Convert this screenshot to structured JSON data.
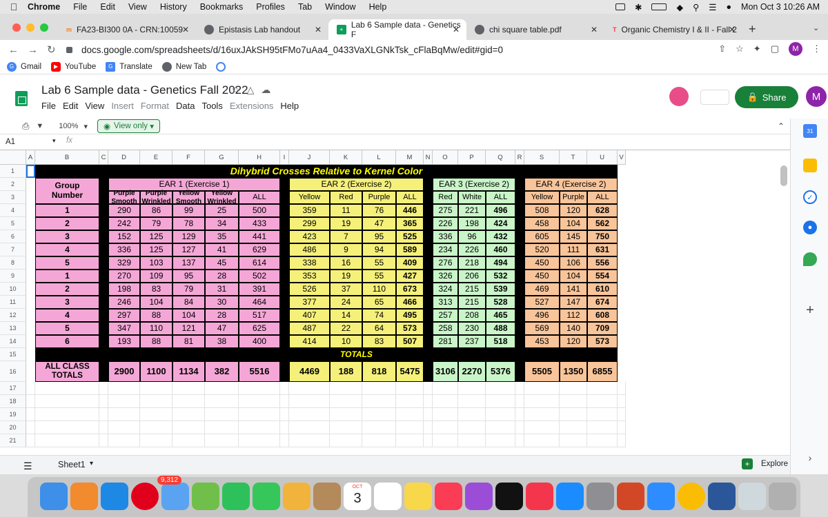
{
  "menubar": {
    "app": "Chrome",
    "items": [
      "File",
      "Edit",
      "View",
      "History",
      "Bookmarks",
      "Profiles",
      "Tab",
      "Window",
      "Help"
    ],
    "clock": "Mon Oct 3  10:26 AM"
  },
  "tabs": [
    {
      "label": "FA23-BI300 0A - CRN:10059",
      "icon": "moodle-icon"
    },
    {
      "label": "Epistasis Lab handout",
      "icon": "globe-icon"
    },
    {
      "label": "Lab 6 Sample data - Genetics F",
      "icon": "sheets-icon"
    },
    {
      "label": "chi square table.pdf",
      "icon": "globe-icon"
    },
    {
      "label": "Organic Chemistry I & II - Fall 2",
      "icon": "tophat-icon"
    }
  ],
  "url": "docs.google.com/spreadsheets/d/16uxJAkSH95tFMo7uAa4_0433VaXLGNkTsk_cFlaBqMw/edit#gid=0",
  "profile_initial": "M",
  "bookmarks": [
    "Gmail",
    "YouTube",
    "Translate",
    "New Tab"
  ],
  "doc": {
    "title": "Lab 6 Sample data - Genetics Fall 2022",
    "menu": [
      "File",
      "Edit",
      "View",
      "Insert",
      "Format",
      "Data",
      "Tools",
      "Extensions",
      "Help"
    ],
    "share_label": "Share",
    "zoom": "100%",
    "view_only": "View only",
    "cell_ref": "A1",
    "fx": "fx"
  },
  "columns": [
    "A",
    "B",
    "C",
    "D",
    "E",
    "F",
    "G",
    "H",
    "I",
    "J",
    "K",
    "L",
    "M",
    "N",
    "O",
    "P",
    "Q",
    "R",
    "S",
    "T",
    "U",
    "V"
  ],
  "rows": [
    "1",
    "2",
    "3",
    "4",
    "5",
    "6",
    "7",
    "8",
    "9",
    "10",
    "11",
    "12",
    "13",
    "14",
    "15",
    "16",
    "17",
    "18",
    "19",
    "20",
    "21"
  ],
  "sheet": {
    "title": "Dihybrid Crosses Relative to Kernel Color",
    "group_header": "Group\nNumber",
    "ear1": {
      "label": "EAR 1 (Exercise 1)",
      "cols": [
        "Purple\nSmooth",
        "Purple\nWrinkled",
        "Yellow\nSmooth",
        "Yellow\nWrinkled",
        "ALL"
      ]
    },
    "ear2": {
      "label": "EAR 2 (Exercise 2)",
      "cols": [
        "Yellow",
        "Red",
        "Purple",
        "ALL"
      ]
    },
    "ear3": {
      "label": "EAR 3 (Exercise 2)",
      "cols": [
        "Red",
        "White",
        "ALL"
      ]
    },
    "ear4": {
      "label": "EAR 4 (Exercise 2)",
      "cols": [
        "Yellow",
        "Purple",
        "ALL"
      ]
    },
    "data": [
      {
        "g": "1",
        "e1": [
          "290",
          "86",
          "99",
          "25",
          "500"
        ],
        "e2": [
          "359",
          "11",
          "76",
          "446"
        ],
        "e3": [
          "275",
          "221",
          "496"
        ],
        "e4": [
          "508",
          "120",
          "628"
        ]
      },
      {
        "g": "2",
        "e1": [
          "242",
          "79",
          "78",
          "34",
          "433"
        ],
        "e2": [
          "299",
          "19",
          "47",
          "365"
        ],
        "e3": [
          "226",
          "198",
          "424"
        ],
        "e4": [
          "458",
          "104",
          "562"
        ]
      },
      {
        "g": "3",
        "e1": [
          "152",
          "125",
          "129",
          "35",
          "441"
        ],
        "e2": [
          "423",
          "7",
          "95",
          "525"
        ],
        "e3": [
          "336",
          "96",
          "432"
        ],
        "e4": [
          "605",
          "145",
          "750"
        ]
      },
      {
        "g": "4",
        "e1": [
          "336",
          "125",
          "127",
          "41",
          "629"
        ],
        "e2": [
          "486",
          "9",
          "94",
          "589"
        ],
        "e3": [
          "234",
          "226",
          "460"
        ],
        "e4": [
          "520",
          "111",
          "631"
        ]
      },
      {
        "g": "5",
        "e1": [
          "329",
          "103",
          "137",
          "45",
          "614"
        ],
        "e2": [
          "338",
          "16",
          "55",
          "409"
        ],
        "e3": [
          "276",
          "218",
          "494"
        ],
        "e4": [
          "450",
          "106",
          "556"
        ]
      },
      {
        "g": "1",
        "e1": [
          "270",
          "109",
          "95",
          "28",
          "502"
        ],
        "e2": [
          "353",
          "19",
          "55",
          "427"
        ],
        "e3": [
          "326",
          "206",
          "532"
        ],
        "e4": [
          "450",
          "104",
          "554"
        ]
      },
      {
        "g": "2",
        "e1": [
          "198",
          "83",
          "79",
          "31",
          "391"
        ],
        "e2": [
          "526",
          "37",
          "110",
          "673"
        ],
        "e3": [
          "324",
          "215",
          "539"
        ],
        "e4": [
          "469",
          "141",
          "610"
        ]
      },
      {
        "g": "3",
        "e1": [
          "246",
          "104",
          "84",
          "30",
          "464"
        ],
        "e2": [
          "377",
          "24",
          "65",
          "466"
        ],
        "e3": [
          "313",
          "215",
          "528"
        ],
        "e4": [
          "527",
          "147",
          "674"
        ]
      },
      {
        "g": "4",
        "e1": [
          "297",
          "88",
          "104",
          "28",
          "517"
        ],
        "e2": [
          "407",
          "14",
          "74",
          "495"
        ],
        "e3": [
          "257",
          "208",
          "465"
        ],
        "e4": [
          "496",
          "112",
          "608"
        ]
      },
      {
        "g": "5",
        "e1": [
          "347",
          "110",
          "121",
          "47",
          "625"
        ],
        "e2": [
          "487",
          "22",
          "64",
          "573"
        ],
        "e3": [
          "258",
          "230",
          "488"
        ],
        "e4": [
          "569",
          "140",
          "709"
        ]
      },
      {
        "g": "6",
        "e1": [
          "193",
          "88",
          "81",
          "38",
          "400"
        ],
        "e2": [
          "414",
          "10",
          "83",
          "507"
        ],
        "e3": [
          "281",
          "237",
          "518"
        ],
        "e4": [
          "453",
          "120",
          "573"
        ]
      }
    ],
    "totals_label": "TOTALS",
    "all_class_label": "ALL CLASS\nTOTALS",
    "totals": {
      "e1": [
        "2900",
        "1100",
        "1134",
        "382",
        "5516"
      ],
      "e2": [
        "4469",
        "188",
        "818",
        "5475"
      ],
      "e3": [
        "3106",
        "2270",
        "5376"
      ],
      "e4": [
        "5505",
        "1350",
        "6855"
      ]
    }
  },
  "sheet_tab": "Sheet1",
  "explore_label": "Explore",
  "dock_badge": "9,312",
  "calendar": {
    "month": "OCT",
    "day": "3"
  },
  "colors": {
    "pink": "#f4a7d6",
    "yellow": "#f5f07a",
    "green": "#c9f5c9",
    "orange": "#f8c49a",
    "title_yellow": "#ffff00",
    "share_green": "#188038"
  }
}
